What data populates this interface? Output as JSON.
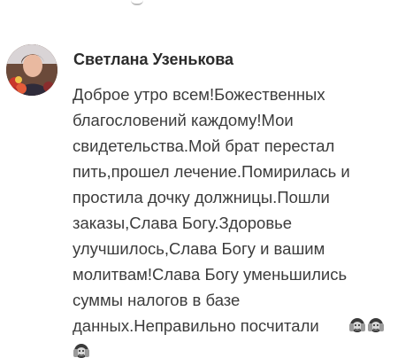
{
  "comment": {
    "author": "Светлана Узенькова",
    "avatar_icon": "user-avatar-photo",
    "text": "Доброе утро всем!Божественных\nблагословений каждому!Мои\nсвидетельства.Мой брат перестал\nпить,прошел лечение.Помирилась и\nпростила дочку должницы.Пошли\nзаказы,Слава Богу.Здоровье\nулучшилось,Слава Богу и вашим\nмолитвам!Слава Богу уменьшились\nсуммы налогов в базе\nданных.Неправильно посчитали",
    "emoji_icons": [
      "hear-no-evil-monkey-icon",
      "hear-no-evil-monkey-icon",
      "hear-no-evil-monkey-icon"
    ]
  }
}
